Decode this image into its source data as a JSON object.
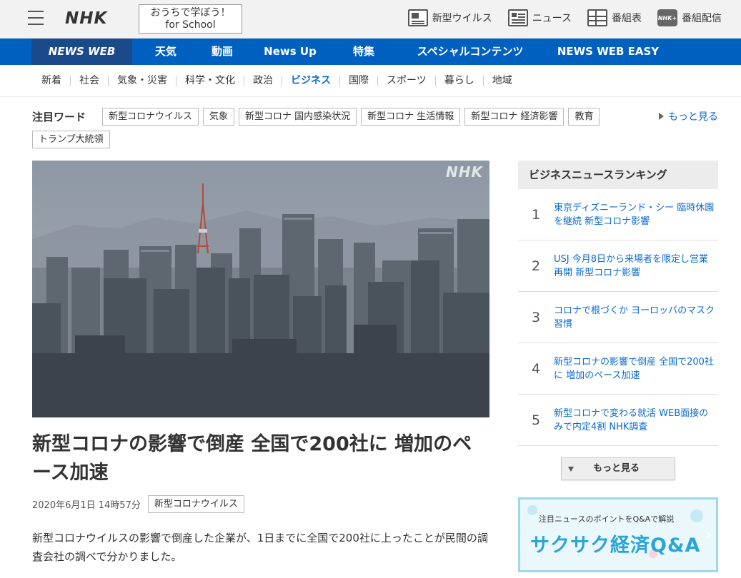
{
  "header": {
    "logo": "NHK",
    "school_line1": "おうちで学ぼう！",
    "school_line2": "for School",
    "links": [
      {
        "label": "新型ウイルス",
        "icon": "corona-icon"
      },
      {
        "label": "ニュース",
        "icon": "news-icon"
      },
      {
        "label": "番組表",
        "icon": "program-guide-icon"
      },
      {
        "label": "番組配信",
        "icon": "nhk-plus-icon",
        "icon_text": "NHK+"
      }
    ]
  },
  "main_nav": [
    "NEWS WEB",
    "天気",
    "動画",
    "News Up",
    "特集",
    "スペシャルコンテンツ",
    "NEWS WEB EASY"
  ],
  "sub_nav": [
    "新着",
    "社会",
    "気象・災害",
    "科学・文化",
    "政治",
    "ビジネス",
    "国際",
    "スポーツ",
    "暮らし",
    "地域"
  ],
  "sub_nav_active": "ビジネス",
  "trending": {
    "label": "注目ワード",
    "tags": [
      "新型コロナウイルス",
      "気象",
      "新型コロナ 国内感染状況",
      "新型コロナ 生活情報",
      "新型コロナ 経済影響",
      "教育"
    ],
    "tag_second_row": "トランプ大統領",
    "more": "もっと見る"
  },
  "hero": {
    "watermark": "NHK"
  },
  "article": {
    "headline": "新型コロナの影響で倒産 全国で200社に 増加のペース加速",
    "date": "2020年6月1日 14時57分",
    "tag": "新型コロナウイルス",
    "body": "新型コロナウイルスの影響で倒産した企業が、1日までに全国で200社に上ったことが民間の調査会社の調べで分かりました。"
  },
  "ranking": {
    "title": "ビジネスニュースランキング",
    "items": [
      {
        "rank": "1",
        "title": "東京ディズニーランド・シー 臨時休園を継続 新型コロナ影響"
      },
      {
        "rank": "2",
        "title": "USJ 今月8日から来場者を限定し営業再開 新型コロナ影響"
      },
      {
        "rank": "3",
        "title": "コロナで根づくか ヨーロッパのマスク習慣"
      },
      {
        "rank": "4",
        "title": "新型コロナの影響で倒産 全国で200社に 増加のペース加速"
      },
      {
        "rank": "5",
        "title": "新型コロナで変わる就活 WEB面接のみで内定4割 NHK調査"
      }
    ],
    "more": "もっと見る"
  },
  "banner": {
    "sub": "注目ニュースのポイントをQ&Aで解説",
    "main": "サクサク経済",
    "qa": "Q&A"
  },
  "colors": {
    "nav_blue": "#0060c0",
    "nav_active": "#1b4a8a",
    "link_blue": "#0a6ad0"
  }
}
